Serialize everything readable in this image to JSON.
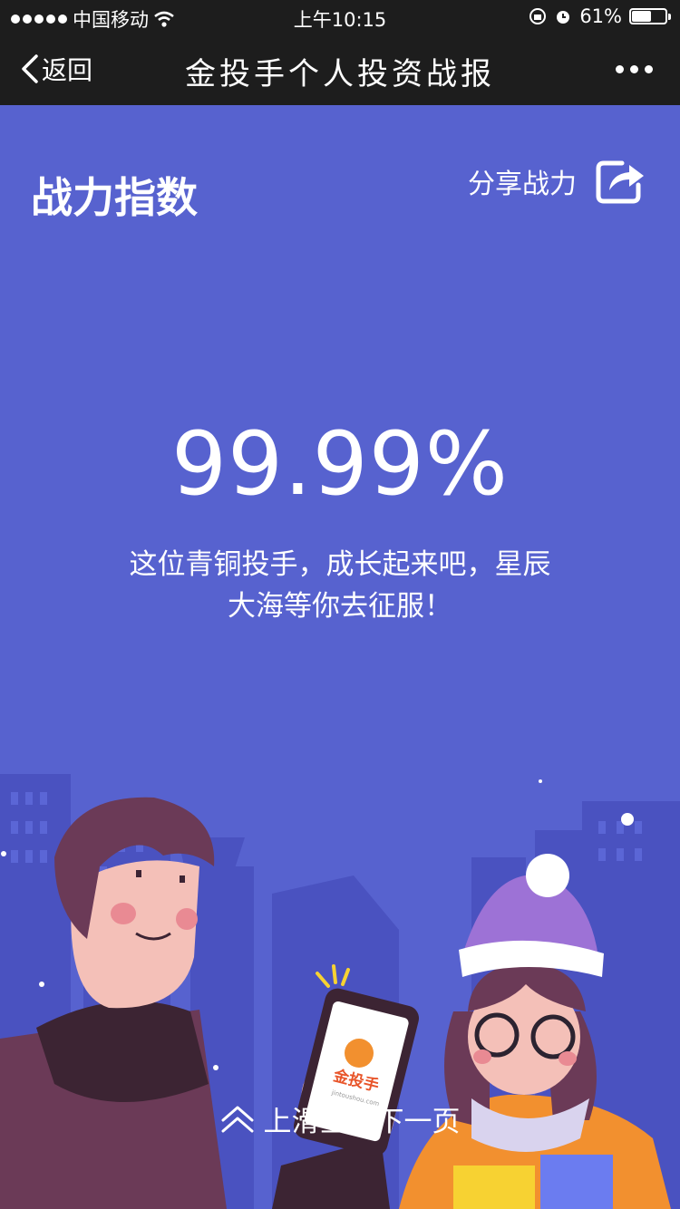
{
  "status": {
    "carrier": "中国移动",
    "time": "上午10:15",
    "battery": "61%",
    "battery_level": 0.61
  },
  "nav": {
    "back_label": "返回",
    "title": "金投手个人投资战报",
    "icons": [
      "chevron-left-icon",
      "more-icon"
    ]
  },
  "content": {
    "section_title": "战力指数",
    "share_label": "分享战力",
    "score": "99.99%",
    "description": "这位青铜投手，成长起来吧，星辰大海等你去征服！",
    "phone_logo": "金投手",
    "phone_url": "jintoushou.com",
    "swipe_hint": "上滑查看下一页"
  },
  "colors": {
    "background": "#5762cf",
    "bar": "#1d1d1d",
    "skyline": "#4a52c0",
    "text": "#ffffff"
  }
}
